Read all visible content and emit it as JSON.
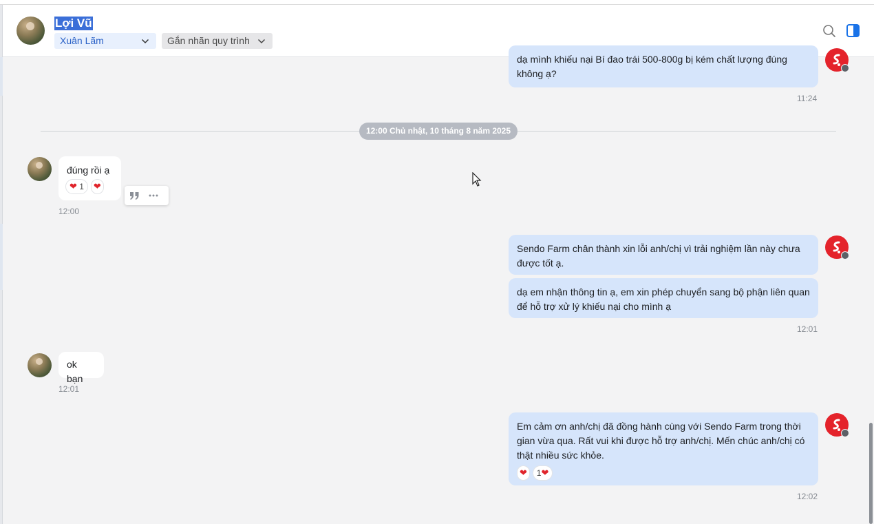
{
  "header": {
    "contact_name": "Lợi Vũ",
    "assignee": "Xuân Lãm",
    "label_placeholder": "Gắn nhãn quy trình",
    "icons": [
      "search-icon",
      "side-panel-icon"
    ]
  },
  "date_divider": "12:00 Chủ nhật, 10 tháng 8 năm 2025",
  "messages": [
    {
      "dir": "out",
      "text": "dạ mình khiếu nại Bí đao trái 500-800g bị kém chất lượng đúng không ạ?",
      "time": "11:24"
    },
    {
      "dir": "in",
      "text": "đúng rồi ạ",
      "reaction_count": "1",
      "time": "12:00"
    },
    {
      "dir": "out",
      "text": "Sendo Farm chân thành xin lỗi anh/chị vì trải nghiệm lần này chưa được tốt ạ."
    },
    {
      "dir": "out",
      "text": "dạ em nhận thông tin ạ, em xin phép chuyển sang bộ phận liên quan để hỗ trợ xử lý khiếu nại cho mình ạ",
      "time": "12:01"
    },
    {
      "dir": "in",
      "text": "ok bạn",
      "time": "12:01"
    },
    {
      "dir": "out",
      "text": "Em cảm ơn anh/chị đã đồng hành cùng với Sendo Farm trong thời gian vừa qua. Rất vui khi được hỗ trợ anh/chị. Mến chúc anh/chị có thật nhiều sức khỏe.",
      "reaction_count": "1",
      "time": "12:02"
    }
  ],
  "colors": {
    "outgoing_bubble": "#d6e5fb",
    "incoming_bubble": "#ffffff",
    "brand_red": "#e4232b",
    "accent_blue": "#2b62c7"
  }
}
